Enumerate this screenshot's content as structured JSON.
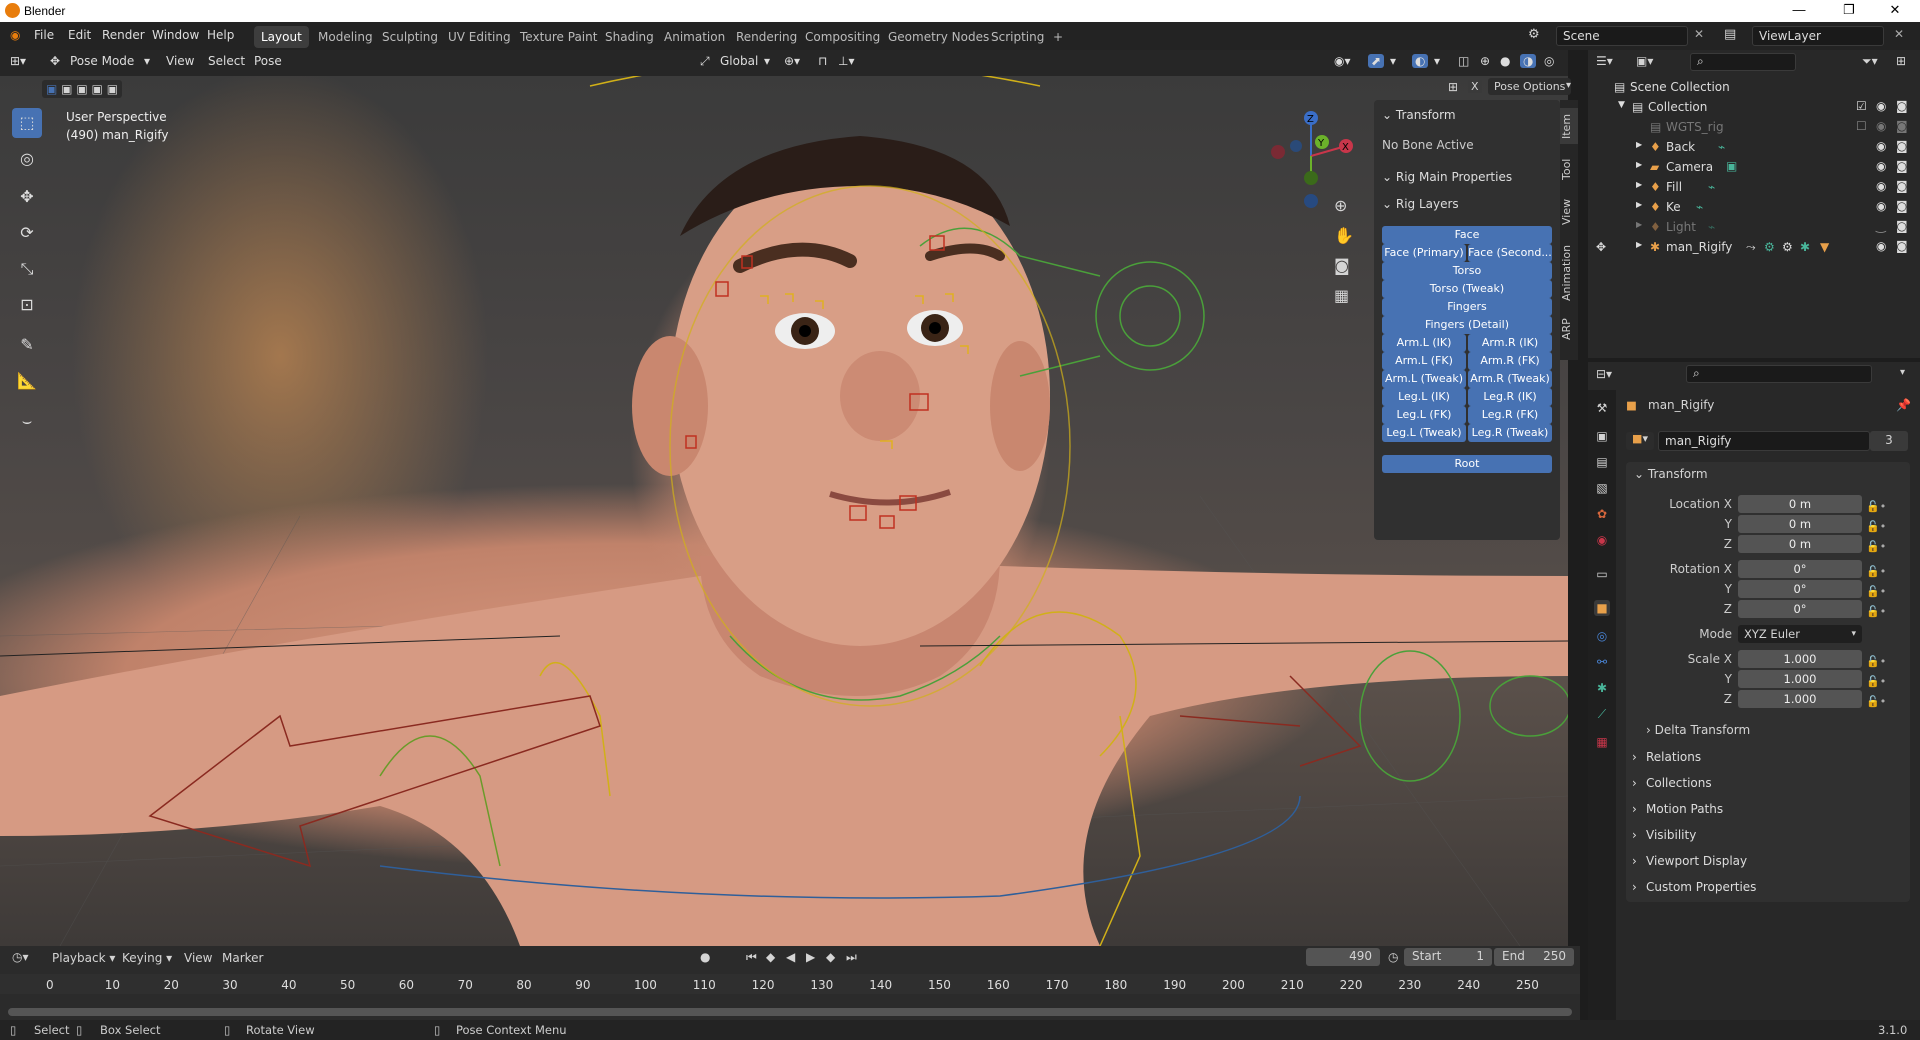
{
  "window": {
    "title": "Blender"
  },
  "menu": {
    "items": [
      "File",
      "Edit",
      "Render",
      "Window",
      "Help"
    ]
  },
  "workspaces": [
    "Layout",
    "Modeling",
    "Sculpting",
    "UV Editing",
    "Texture Paint",
    "Shading",
    "Animation",
    "Rendering",
    "Compositing",
    "Geometry Nodes",
    "Scripting",
    "+"
  ],
  "scene": {
    "name": "Scene",
    "view_layer": "ViewLayer"
  },
  "viewport": {
    "mode": "Pose Mode",
    "menus": [
      "View",
      "Select",
      "Pose"
    ],
    "orientation": "Global",
    "pose_options": "Pose Options",
    "info_line1": "User Perspective",
    "info_line2": "(490) man_Rigify"
  },
  "npanel": {
    "tabs": [
      "Item",
      "Tool",
      "View",
      "Animation",
      "ARP"
    ],
    "transform_header": "Transform",
    "no_bone": "No Bone Active",
    "rig_main": "Rig Main Properties",
    "rig_layers": "Rig Layers",
    "layers_full": [
      "Face"
    ],
    "layers_pairs": [
      [
        "Face (Primary)",
        "Face (Second..."
      ]
    ],
    "layers_full2": [
      "Torso",
      "Torso (Tweak)",
      "Fingers",
      "Fingers (Detail)"
    ],
    "layers_pairs2": [
      [
        "Arm.L (IK)",
        "Arm.R (IK)"
      ],
      [
        "Arm.L (FK)",
        "Arm.R (FK)"
      ],
      [
        "Arm.L (Tweak)",
        "Arm.R (Tweak)"
      ],
      [
        "Leg.L (IK)",
        "Leg.R (IK)"
      ],
      [
        "Leg.L (FK)",
        "Leg.R (FK)"
      ],
      [
        "Leg.L (Tweak)",
        "Leg.R (Tweak)"
      ]
    ],
    "root": "Root"
  },
  "outliner": {
    "scene_collection": "Scene Collection",
    "collection": "Collection",
    "items": [
      "WGTS_rig",
      "Back",
      "Camera",
      "Fill",
      "Ke",
      "Light",
      "man_Rigify"
    ]
  },
  "properties": {
    "object_name": "man_Rigify",
    "data_name": "man_Rigify",
    "users": "3",
    "transform": "Transform",
    "location_label": "Location X",
    "rotation_label": "Rotation X",
    "scale_label": "Scale X",
    "y_label": "Y",
    "z_label": "Z",
    "mode_label": "Mode",
    "location": [
      "0 m",
      "0 m",
      "0 m"
    ],
    "rotation": [
      "0°",
      "0°",
      "0°"
    ],
    "mode": "XYZ Euler",
    "scale": [
      "1.000",
      "1.000",
      "1.000"
    ],
    "delta": "Delta Transform",
    "sections": [
      "Relations",
      "Collections",
      "Motion Paths",
      "Visibility",
      "Viewport Display",
      "Custom Properties"
    ]
  },
  "timeline": {
    "menus": [
      "Playback",
      "Keying",
      "View",
      "Marker"
    ],
    "current_frame": "490",
    "start_label": "Start",
    "start": "1",
    "end_label": "End",
    "end": "250",
    "ticks": [
      "0",
      "10",
      "20",
      "30",
      "40",
      "50",
      "60",
      "70",
      "80",
      "90",
      "100",
      "110",
      "120",
      "130",
      "140",
      "150",
      "160",
      "170",
      "180",
      "190",
      "200",
      "210",
      "220",
      "230",
      "240",
      "250"
    ]
  },
  "status": {
    "select": "Select",
    "box_select": "Box Select",
    "rotate": "Rotate View",
    "context": "Pose Context Menu",
    "version": "3.1.0"
  },
  "colors": {
    "accent": "#4772b3",
    "orange": "#e87d0d"
  }
}
